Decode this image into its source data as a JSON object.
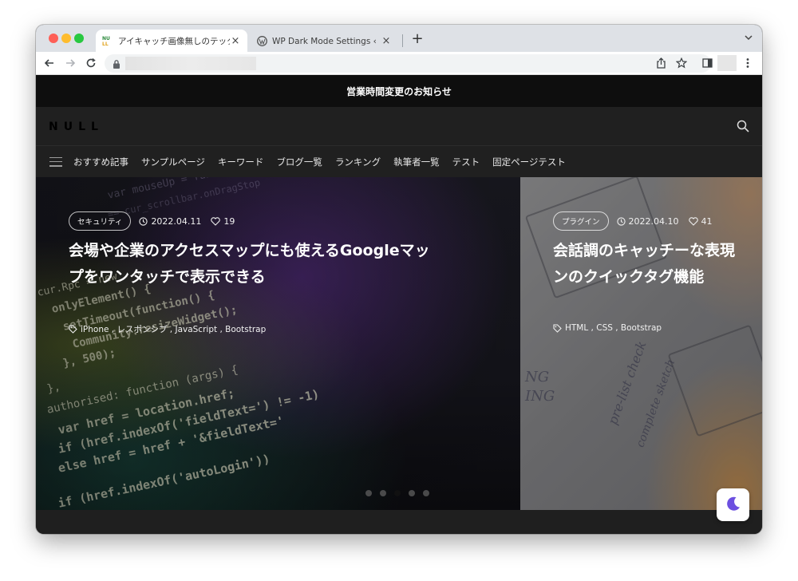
{
  "browser": {
    "tabs": [
      {
        "title": "アイキャッチ画像無しのテックブロ",
        "favicon": "null-logo-icon",
        "active": true
      },
      {
        "title": "WP Dark Mode Settings ‹「NUL",
        "favicon": "wordpress-icon",
        "active": false
      }
    ],
    "new_tab": "+",
    "close": "×",
    "dropdown": "⌄"
  },
  "site": {
    "notice": "営業時間変更のお知らせ",
    "logo": "NULL",
    "nav": [
      "おすすめ記事",
      "サンプルページ",
      "キーワード",
      "ブログ一覧",
      "ランキング",
      "執筆者一覧",
      "テスト",
      "固定ページテスト"
    ]
  },
  "slides": [
    {
      "category": "セキュリティ",
      "date": "2022.04.11",
      "likes": "19",
      "title_line1": "会場や企業のアクセスマップにも使えるGoogleマッ",
      "title_line2": "プをワンタッチで表示できる",
      "tags": "iPhone , レスポンシブ , JavaScript , Bootstrap"
    },
    {
      "category": "プラグイン",
      "date": "2022.04.10",
      "likes": "41",
      "title_line1": "会話調のキャッチーな表現",
      "title_line2": "ンのクイックタグ機能",
      "tags": "HTML , CSS , Bootstrap"
    }
  ],
  "slider": {
    "dots": 5,
    "active_index": 2
  },
  "colors": {
    "accent_moon": "#6c4fe0",
    "notice_bg": "#0e0e0e",
    "header_bg": "#202020"
  }
}
